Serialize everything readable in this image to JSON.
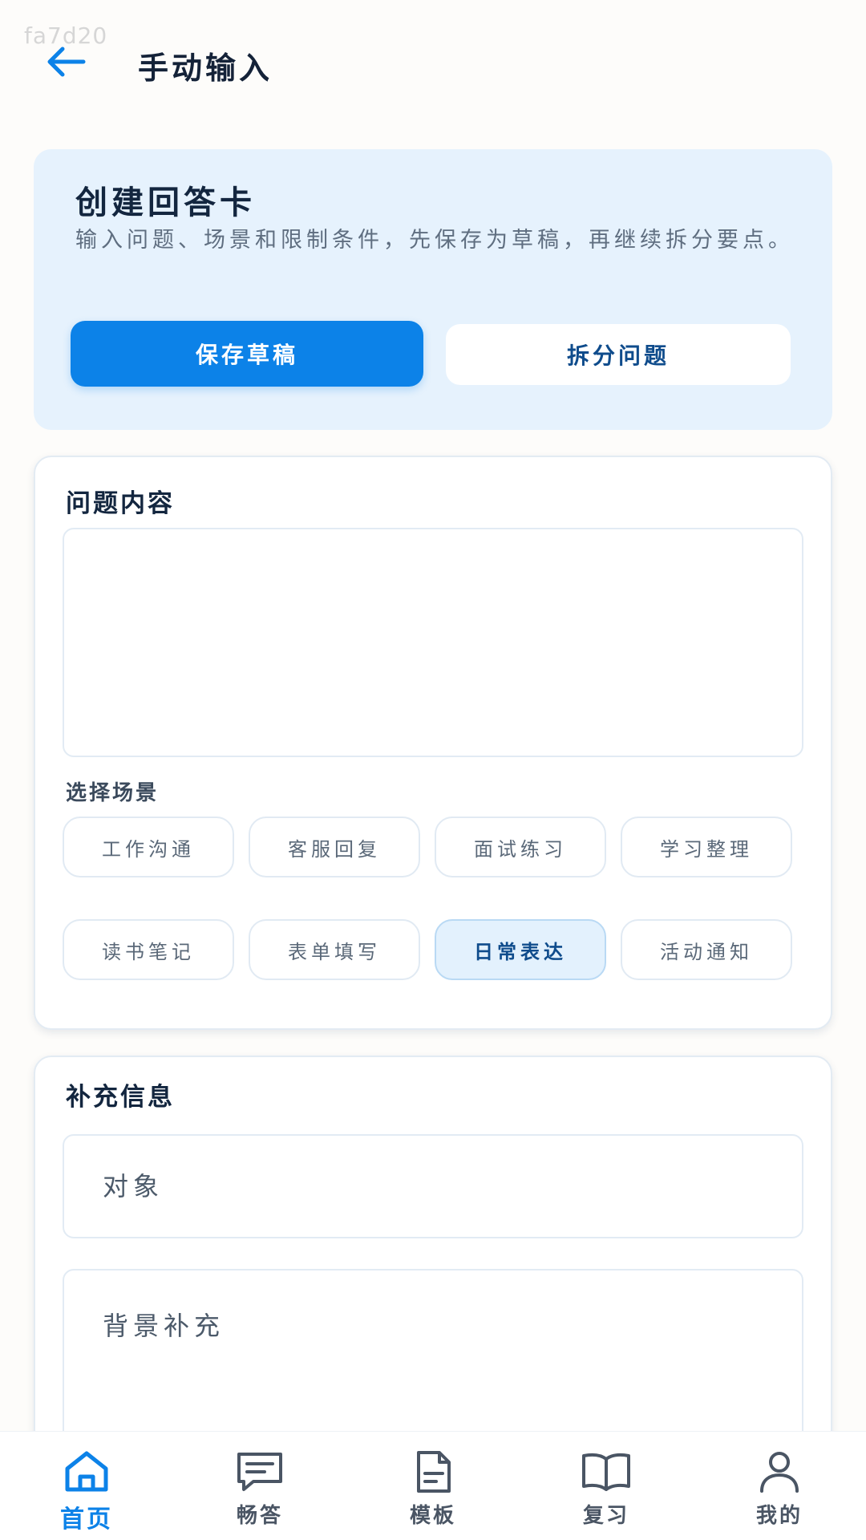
{
  "watermark": "fa7d20",
  "header": {
    "title": "手动输入"
  },
  "hero": {
    "title": "创建回答卡",
    "description": "输入问题、场景和限制条件，先保存为草稿，再继续拆分要点。",
    "save_draft_label": "保存草稿",
    "split_question_label": "拆分问题"
  },
  "question": {
    "title": "问题内容",
    "textarea_value": "",
    "scene_label": "选择场景",
    "scenes": [
      {
        "label": "工作沟通",
        "selected": false
      },
      {
        "label": "客服回复",
        "selected": false
      },
      {
        "label": "面试练习",
        "selected": false
      },
      {
        "label": "学习整理",
        "selected": false
      },
      {
        "label": "读书笔记",
        "selected": false
      },
      {
        "label": "表单填写",
        "selected": false
      },
      {
        "label": "日常表达",
        "selected": true
      },
      {
        "label": "活动通知",
        "selected": false
      }
    ]
  },
  "supplement": {
    "title": "补充信息",
    "target_placeholder": "对象",
    "background_placeholder": "背景补充"
  },
  "nav": {
    "items": [
      {
        "label": "首页",
        "icon": "home-icon",
        "active": true
      },
      {
        "label": "畅答",
        "icon": "chat-icon",
        "active": false
      },
      {
        "label": "模板",
        "icon": "document-icon",
        "active": false
      },
      {
        "label": "复习",
        "icon": "book-icon",
        "active": false
      },
      {
        "label": "我的",
        "icon": "user-icon",
        "active": false
      }
    ]
  },
  "colors": {
    "accent": "#0c82e8",
    "hero_bg": "#e6f2fd",
    "page_bg": "#fdfcfa"
  }
}
